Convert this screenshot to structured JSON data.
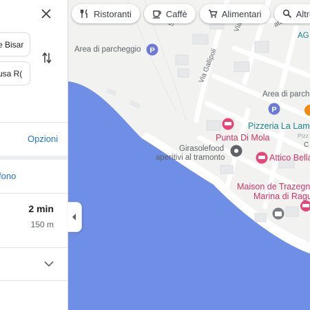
{
  "filter_chips": [
    {
      "label": "Ristoranti",
      "icon": "fork-knife-icon"
    },
    {
      "label": "Caffè",
      "icon": "coffee-cup-icon"
    },
    {
      "label": "Alimentari",
      "icon": "shopping-cart-icon"
    },
    {
      "label": "Altro",
      "icon": "search-icon"
    }
  ],
  "directions_panel": {
    "origin_value": "e Bisar",
    "destination_value": "usa R(",
    "options_label": "Opzioni",
    "phone_label": "fono",
    "route": {
      "duration": "2 min",
      "distance": "150 m"
    }
  },
  "map_labels": {
    "parking_1": "Area di parcheggio",
    "parking_2": "Area di parche",
    "street_gallipoli": "Via Gallipoli",
    "street_top_1": "Via",
    "street_top_2": "S",
    "street_top_right": "attiviano",
    "place_ag": "AG",
    "pizzeria": "Pizzeria La Lamp",
    "pizzeria_sub": "Pizz",
    "punta_di_mola": "Punta Di Mola",
    "girasole_line1": "Girasolefood",
    "girasole_line2": "aperitivi al tramonto",
    "attico": "Attico Bella",
    "maison_line1": "Maison de Trazegni",
    "maison_line2": "Marina di Ragu",
    "letter_c": "C"
  },
  "colors": {
    "water": "#6f8ee6",
    "land": "#f2f3f1",
    "link": "#1a73e8",
    "hotel_pin": "#e8447a",
    "food_pin": "#ef8a12",
    "parking_pin": "#6b79d8",
    "teal_text": "#12858f",
    "pink_text": "#d6336c"
  }
}
